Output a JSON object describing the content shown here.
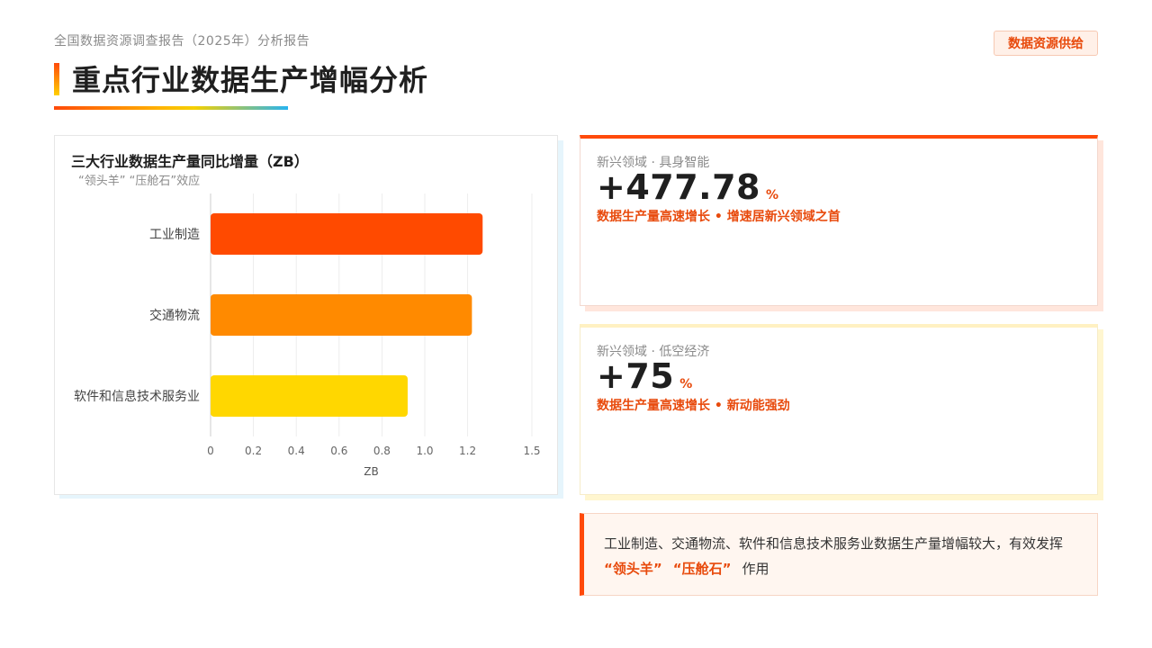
{
  "header": {
    "report_name": "全国数据资源调查报告（2025年）分析报告",
    "tag": "数据资源供给",
    "title": "重点行业数据生产增幅分析"
  },
  "colors": {
    "accent": "#e84a0c",
    "bar_1": "#ff4a00",
    "bar_2": "#ff8a00",
    "bar_3": "#ffd700",
    "card1_top": "#ff4a0a",
    "card1_shadow": "#ffe6dc",
    "card2_top": "#fff1c2",
    "card2_shadow": "#fff6d0"
  },
  "chart_data": {
    "type": "bar",
    "orientation": "horizontal",
    "title": "三大行业数据生产量同比增量（ZB）",
    "subtitle": "“领头羊” “压舱石”效应",
    "categories": [
      "工业制造",
      "交通物流",
      "软件和信息技术服务业"
    ],
    "values": [
      1.27,
      1.22,
      0.92
    ],
    "xlabel": "ZB",
    "xlim": [
      0,
      1.5
    ],
    "xticks": [
      "0",
      "0.2",
      "0.4",
      "0.6",
      "0.8",
      "1.0",
      "1.2",
      "1.5"
    ],
    "xtick_values": [
      0,
      0.2,
      0.4,
      0.6,
      0.8,
      1.0,
      1.2,
      1.5
    ],
    "grid": true,
    "legend": "none"
  },
  "stats": [
    {
      "label": "新兴领域 · 具身智能",
      "value": "+477.78",
      "unit": "%",
      "desc": "数据生产量高速增长 • 增速居新兴领域之首"
    },
    {
      "label": "新兴领域 · 低空经济",
      "value": "+75",
      "unit": "%",
      "desc": "数据生产量高速增长 • 新动能强劲"
    }
  ],
  "note": {
    "text": "工业制造、交通物流、软件和信息技术服务业数据生产量增幅较大，有效发挥",
    "highlight1": "“领头羊”",
    "highlight2": "“压舱石”",
    "suffix": "作用"
  }
}
